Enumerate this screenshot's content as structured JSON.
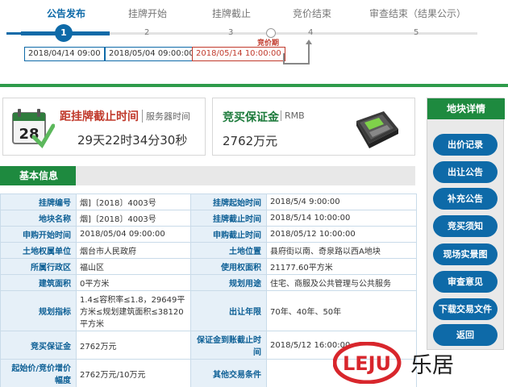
{
  "steps": [
    {
      "title": "公告发布",
      "num": "1"
    },
    {
      "title": "挂牌开始",
      "num": "2"
    },
    {
      "title": "挂牌截止",
      "num": "3"
    },
    {
      "title": "竞价结束",
      "num": "4"
    },
    {
      "title": "审查结束（结果公示）",
      "num": "5"
    }
  ],
  "bid_period_label": "竞价期",
  "step_dates": [
    "2018/04/14 09:00",
    "2018/05/04 09:00:00",
    "2018/05/14 10:00:00"
  ],
  "countdown": {
    "title": "距挂牌截止时间",
    "subtitle": "服务器时间",
    "time": "29天22时34分30秒",
    "calendar_day": "28"
  },
  "deposit": {
    "title": "竞买保证金",
    "unit": "RMB",
    "value": "2762万元"
  },
  "basic_info": {
    "tab": "基本信息",
    "rows": [
      {
        "l1": "挂牌编号",
        "v1": "烟]〔2018〕4003号",
        "l2": "挂牌起始时间",
        "v2": "2018/5/4 9:00:00"
      },
      {
        "l1": "地块名称",
        "v1": "烟]〔2018〕4003号",
        "l2": "挂牌截止时间",
        "v2": "2018/5/14 10:00:00"
      },
      {
        "l1": "申购开始时间",
        "v1": "2018/05/04 09:00:00",
        "l2": "申购截止时间",
        "v2": "2018/05/12 10:00:00"
      },
      {
        "l1": "土地权属单位",
        "v1": "烟台市人民政府",
        "l2": "土地位置",
        "v2": "县府街以南、奇泉路以西A地块"
      },
      {
        "l1": "所属行政区",
        "v1": "福山区",
        "l2": "使用权面积",
        "v2": "21177.60平方米"
      },
      {
        "l1": "建筑面积",
        "v1": "0平方米",
        "l2": "规划用途",
        "v2": "住宅、商服及公共管理与公共服务"
      },
      {
        "l1": "规划指标",
        "v1": "1.4≤容积率≤1.8，29649平方米≤规划建筑面积≤38120平方米",
        "l2": "出让年限",
        "v2": "70年、40年、50年"
      },
      {
        "l1": "竞买保证金",
        "v1": "2762万元",
        "l2": "保证金到账截止时间",
        "v2": "2018/5/12 16:00:00"
      },
      {
        "l1": "起始价/竞价增价幅度",
        "v1": "2762万元/10万元",
        "l2": "其他交易条件",
        "v2": ""
      }
    ]
  },
  "sidebar": {
    "title": "地块详情",
    "buttons": [
      "出价记录",
      "出让公告",
      "补充公告",
      "竞买须知",
      "现场实景图",
      "审查意见",
      "下载交易文件",
      "返回"
    ]
  },
  "watermark": {
    "brand": "LEJU",
    "text": "乐居"
  },
  "colors": {
    "primary_blue": "#0e6aa8",
    "green": "#1e8a3f",
    "red": "#c0392b"
  }
}
